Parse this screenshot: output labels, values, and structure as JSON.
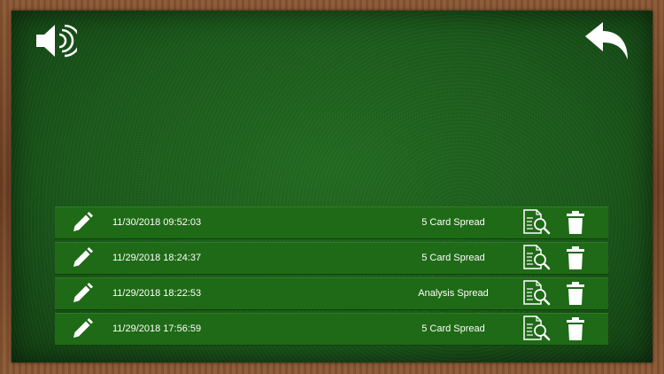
{
  "header": {
    "sound_icon": "speaker-icon",
    "back_icon": "back-arrow-icon"
  },
  "spreads": [
    {
      "datetime": "11/30/2018 09:52:03",
      "name": "5 Card Spread"
    },
    {
      "datetime": "11/29/2018 18:24:37",
      "name": "5 Card Spread"
    },
    {
      "datetime": "11/29/2018 18:22:53",
      "name": "Analysis Spread"
    },
    {
      "datetime": "11/29/2018 17:56:59",
      "name": "5 Card Spread"
    }
  ],
  "row_icons": {
    "edit": "pencil-icon",
    "view": "document-search-icon",
    "delete": "trash-icon"
  },
  "colors": {
    "felt": "#1b5a1b",
    "row": "#1f6a16",
    "frame": "#7a4a2a",
    "icon": "#ffffff"
  }
}
